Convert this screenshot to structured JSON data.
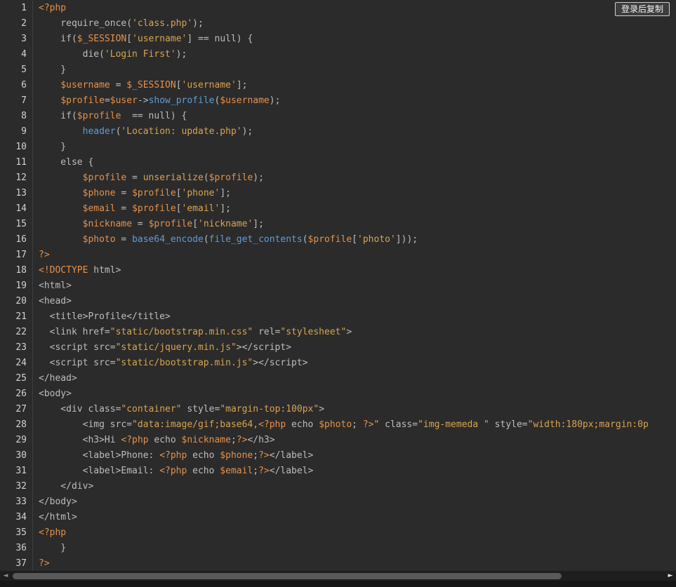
{
  "copy_button": {
    "label": "登录后复制"
  },
  "palette": {
    "p": "#bdbdbd",
    "o": "#e5914a",
    "s": "#d7a44f",
    "b": "#d7a44f",
    "f": "#5c9dd8",
    "line_number": "#d2d2d2",
    "background": "#2b2b2b",
    "gutter_divider": "#3f3f3f",
    "scrollbar_track": "#1e1e1e",
    "scrollbar_thumb": "#5a5a5a"
  },
  "scrollbar": {
    "left_arrow": "◄",
    "right_arrow": "►"
  },
  "code": {
    "language": "php",
    "lines": [
      {
        "no": 1,
        "t": [
          [
            "o",
            "<?php"
          ]
        ]
      },
      {
        "no": 2,
        "t": [
          [
            "p",
            "    require_once("
          ],
          [
            "s",
            "'class.php'"
          ],
          [
            "p",
            ");"
          ]
        ]
      },
      {
        "no": 3,
        "t": [
          [
            "p",
            "    if("
          ],
          [
            "o",
            "$_SESSION"
          ],
          [
            "p",
            "["
          ],
          [
            "s",
            "'username'"
          ],
          [
            "p",
            "] == null) {"
          ]
        ]
      },
      {
        "no": 4,
        "t": [
          [
            "p",
            "        die("
          ],
          [
            "s",
            "'Login First'"
          ],
          [
            "p",
            ");"
          ]
        ]
      },
      {
        "no": 5,
        "t": [
          [
            "p",
            "    }"
          ]
        ]
      },
      {
        "no": 6,
        "t": [
          [
            "p",
            "    "
          ],
          [
            "o",
            "$username"
          ],
          [
            "p",
            " = "
          ],
          [
            "o",
            "$_SESSION"
          ],
          [
            "p",
            "["
          ],
          [
            "s",
            "'username'"
          ],
          [
            "p",
            "];"
          ]
        ]
      },
      {
        "no": 7,
        "t": [
          [
            "p",
            "    "
          ],
          [
            "o",
            "$profile"
          ],
          [
            "p",
            "="
          ],
          [
            "o",
            "$user"
          ],
          [
            "p",
            "->"
          ],
          [
            "f",
            "show_profile"
          ],
          [
            "p",
            "("
          ],
          [
            "o",
            "$username"
          ],
          [
            "p",
            ");"
          ]
        ]
      },
      {
        "no": 8,
        "t": [
          [
            "p",
            "    if("
          ],
          [
            "o",
            "$profile"
          ],
          [
            "p",
            "  == null) {"
          ]
        ]
      },
      {
        "no": 9,
        "t": [
          [
            "p",
            "        "
          ],
          [
            "f",
            "header"
          ],
          [
            "p",
            "("
          ],
          [
            "s",
            "'Location: update.php'"
          ],
          [
            "p",
            ");"
          ]
        ]
      },
      {
        "no": 10,
        "t": [
          [
            "p",
            "    }"
          ]
        ]
      },
      {
        "no": 11,
        "t": [
          [
            "p",
            "    else {"
          ]
        ]
      },
      {
        "no": 12,
        "t": [
          [
            "p",
            "        "
          ],
          [
            "o",
            "$profile"
          ],
          [
            "p",
            " = "
          ],
          [
            "b",
            "unserialize"
          ],
          [
            "p",
            "("
          ],
          [
            "o",
            "$profile"
          ],
          [
            "p",
            ");"
          ]
        ]
      },
      {
        "no": 13,
        "t": [
          [
            "p",
            "        "
          ],
          [
            "o",
            "$phone"
          ],
          [
            "p",
            " = "
          ],
          [
            "o",
            "$profile"
          ],
          [
            "p",
            "["
          ],
          [
            "s",
            "'phone'"
          ],
          [
            "p",
            "];"
          ]
        ]
      },
      {
        "no": 14,
        "t": [
          [
            "p",
            "        "
          ],
          [
            "o",
            "$email"
          ],
          [
            "p",
            " = "
          ],
          [
            "o",
            "$profile"
          ],
          [
            "p",
            "["
          ],
          [
            "s",
            "'email'"
          ],
          [
            "p",
            "];"
          ]
        ]
      },
      {
        "no": 15,
        "t": [
          [
            "p",
            "        "
          ],
          [
            "o",
            "$nickname"
          ],
          [
            "p",
            " = "
          ],
          [
            "o",
            "$profile"
          ],
          [
            "p",
            "["
          ],
          [
            "s",
            "'nickname'"
          ],
          [
            "p",
            "];"
          ]
        ]
      },
      {
        "no": 16,
        "t": [
          [
            "p",
            "        "
          ],
          [
            "o",
            "$photo"
          ],
          [
            "p",
            " = "
          ],
          [
            "f",
            "base64_encode"
          ],
          [
            "p",
            "("
          ],
          [
            "f",
            "file_get_contents"
          ],
          [
            "p",
            "("
          ],
          [
            "o",
            "$profile"
          ],
          [
            "p",
            "["
          ],
          [
            "s",
            "'photo'"
          ],
          [
            "p",
            "]));"
          ]
        ]
      },
      {
        "no": 17,
        "t": [
          [
            "o",
            "?>"
          ]
        ]
      },
      {
        "no": 18,
        "t": [
          [
            "o",
            "<!DOCTYPE"
          ],
          [
            "p",
            " html>"
          ]
        ]
      },
      {
        "no": 19,
        "t": [
          [
            "p",
            "<html>"
          ]
        ]
      },
      {
        "no": 20,
        "t": [
          [
            "p",
            "<head>"
          ]
        ]
      },
      {
        "no": 21,
        "t": [
          [
            "p",
            "  <title>Profile</title>"
          ]
        ]
      },
      {
        "no": 22,
        "t": [
          [
            "p",
            "  <link href="
          ],
          [
            "s",
            "\"static/bootstrap.min.css\""
          ],
          [
            "p",
            " rel="
          ],
          [
            "s",
            "\"stylesheet\""
          ],
          [
            "p",
            ">"
          ]
        ]
      },
      {
        "no": 23,
        "t": [
          [
            "p",
            "  <script src="
          ],
          [
            "s",
            "\"static/jquery.min.js\""
          ],
          [
            "p",
            "></script>"
          ]
        ]
      },
      {
        "no": 24,
        "t": [
          [
            "p",
            "  <script src="
          ],
          [
            "s",
            "\"static/bootstrap.min.js\""
          ],
          [
            "p",
            "></script>"
          ]
        ]
      },
      {
        "no": 25,
        "t": [
          [
            "p",
            "</head>"
          ]
        ]
      },
      {
        "no": 26,
        "t": [
          [
            "p",
            "<body>"
          ]
        ]
      },
      {
        "no": 27,
        "t": [
          [
            "p",
            "    <div class="
          ],
          [
            "s",
            "\"container\""
          ],
          [
            "p",
            " style="
          ],
          [
            "s",
            "\"margin-top:100px\""
          ],
          [
            "p",
            ">"
          ]
        ]
      },
      {
        "no": 28,
        "t": [
          [
            "p",
            "        <img src="
          ],
          [
            "s",
            "\"data:image/gif;base64,"
          ],
          [
            "o",
            "<?php"
          ],
          [
            "p",
            " echo "
          ],
          [
            "o",
            "$photo"
          ],
          [
            "p",
            "; "
          ],
          [
            "o",
            "?>"
          ],
          [
            "s",
            "\""
          ],
          [
            "p",
            " class="
          ],
          [
            "s",
            "\"img-memeda \""
          ],
          [
            "p",
            " style="
          ],
          [
            "s",
            "\"width:180px;margin:0p"
          ]
        ]
      },
      {
        "no": 29,
        "t": [
          [
            "p",
            "        <h3>Hi "
          ],
          [
            "o",
            "<?php"
          ],
          [
            "p",
            " echo "
          ],
          [
            "o",
            "$nickname"
          ],
          [
            "p",
            ";"
          ],
          [
            "o",
            "?>"
          ],
          [
            "p",
            "</h3>"
          ]
        ]
      },
      {
        "no": 30,
        "t": [
          [
            "p",
            "        <label>Phone: "
          ],
          [
            "o",
            "<?php"
          ],
          [
            "p",
            " echo "
          ],
          [
            "o",
            "$phone"
          ],
          [
            "p",
            ";"
          ],
          [
            "o",
            "?>"
          ],
          [
            "p",
            "</label>"
          ]
        ]
      },
      {
        "no": 31,
        "t": [
          [
            "p",
            "        <label>Email: "
          ],
          [
            "o",
            "<?php"
          ],
          [
            "p",
            " echo "
          ],
          [
            "o",
            "$email"
          ],
          [
            "p",
            ";"
          ],
          [
            "o",
            "?>"
          ],
          [
            "p",
            "</label>"
          ]
        ]
      },
      {
        "no": 32,
        "t": [
          [
            "p",
            "    </div>"
          ]
        ]
      },
      {
        "no": 33,
        "t": [
          [
            "p",
            "</body>"
          ]
        ]
      },
      {
        "no": 34,
        "t": [
          [
            "p",
            "</html>"
          ]
        ]
      },
      {
        "no": 35,
        "t": [
          [
            "o",
            "<?php"
          ]
        ]
      },
      {
        "no": 36,
        "t": [
          [
            "p",
            "    }"
          ]
        ]
      },
      {
        "no": 37,
        "t": [
          [
            "o",
            "?>"
          ]
        ]
      }
    ]
  }
}
